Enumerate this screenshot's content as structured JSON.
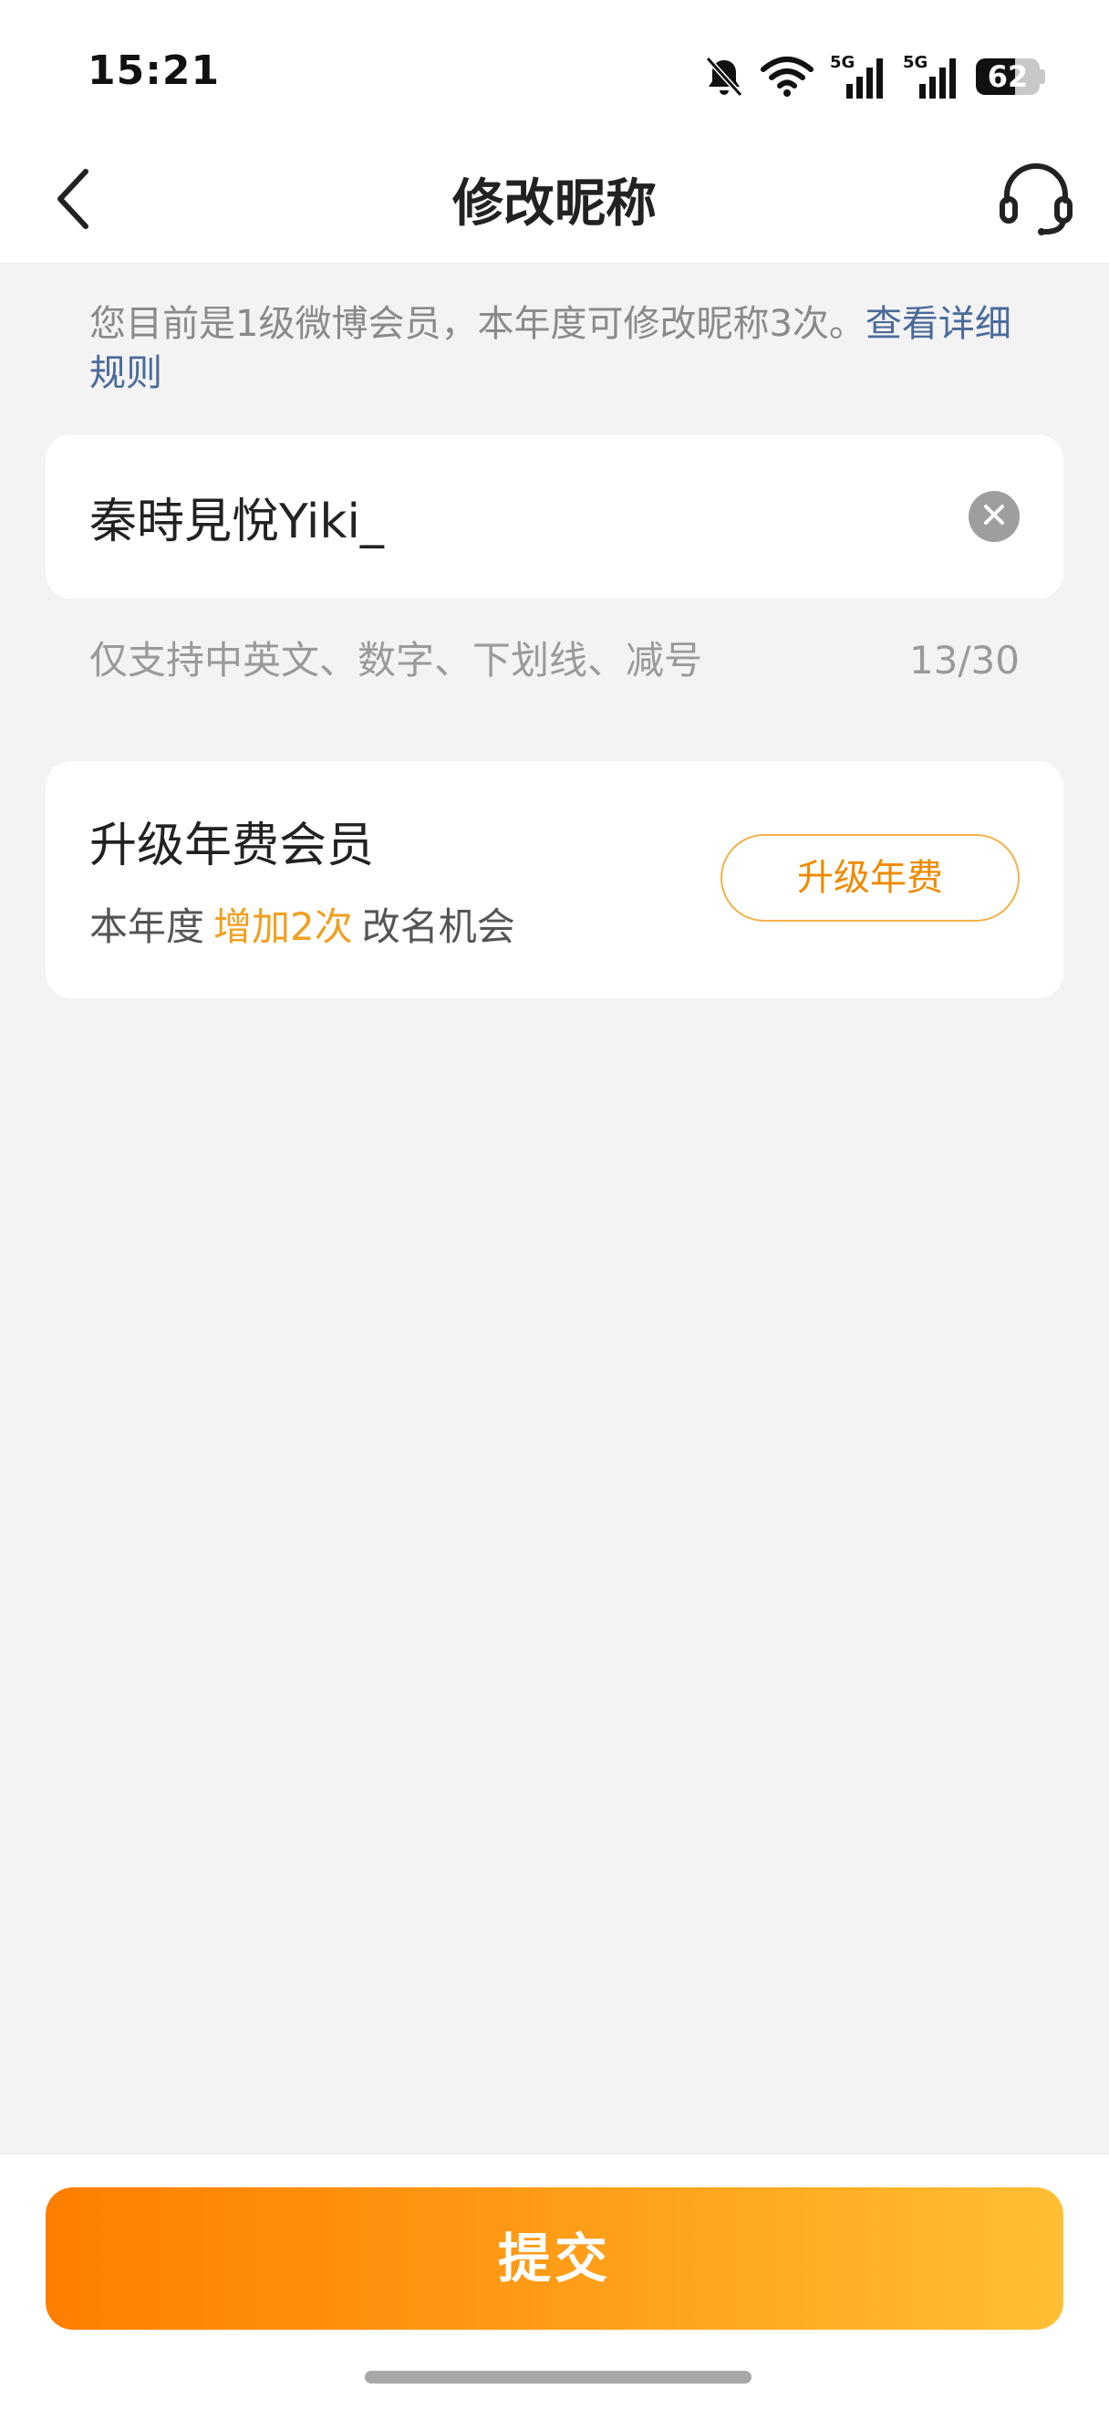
{
  "status_bar": {
    "time": "15:21",
    "network_label": "5G",
    "battery_percent": 62,
    "icons": [
      "bell-muted-icon",
      "wifi-icon",
      "signal-5g-icon",
      "signal-5g-icon",
      "battery-icon"
    ]
  },
  "navbar": {
    "title": "修改昵称",
    "back_icon": "chevron-left-icon",
    "service_icon": "headset-icon"
  },
  "info": {
    "text": "您目前是1级微博会员，本年度可修改昵称3次。",
    "link": "查看详细规则"
  },
  "nickname": {
    "value": "秦時見悅Yiki_",
    "clear_icon": "clear-icon"
  },
  "hint": {
    "text": "仅支持中英文、数字、下划线、减号",
    "counter": "13/30"
  },
  "upgrade": {
    "title": "升级年费会员",
    "sub_prefix": "本年度",
    "sub_highlight": "增加2次",
    "sub_suffix": "改名机会",
    "button_label": "升级年费"
  },
  "submit": {
    "label": "提交"
  },
  "colors": {
    "accent_orange": "#ff7e00",
    "accent_yellow": "#ffbf35",
    "highlight": "#f0a020",
    "link": "#4a6a9a",
    "background": "#f3f3f3"
  }
}
